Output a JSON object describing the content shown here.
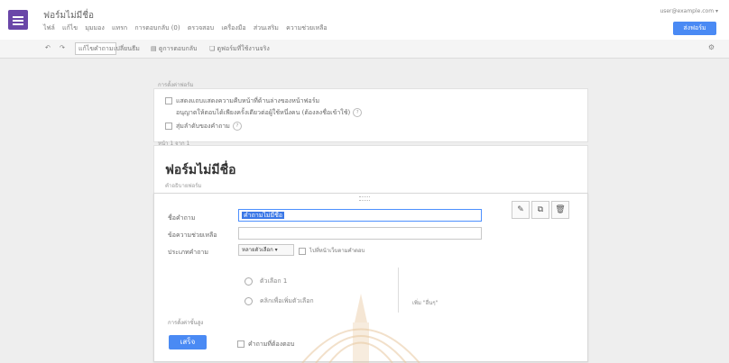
{
  "header": {
    "title": "ฟอร์มไม่มีชื่อ",
    "menu": [
      "ไฟล์",
      "แก้ไข",
      "มุมมอง",
      "แทรก",
      "การตอบกลับ (0)",
      "ตรวจสอบ",
      "เครื่องมือ",
      "ส่วนเสริม",
      "ความช่วยเหลือ"
    ],
    "account": "user@example.com",
    "send_label": "ส่งฟอร์ม"
  },
  "toolbar": {
    "undo": "↶",
    "redo": "↷",
    "edit_questions": "แก้ไขคำถาม",
    "change_theme": "เปลี่ยนธีม",
    "view_responses": "ดูการตอบกลับ",
    "view_live_form": "ดูฟอร์มที่ใช้งานจริง",
    "settings_icon": "gear"
  },
  "settings": {
    "label": "การตั้งค่าฟอร์ม",
    "items": [
      "แสดงแถบแสดงความคืบหน้าที่ด้านล่างของหน้าฟอร์ม",
      "อนุญาตให้ตอบได้เพียงครั้งเดียวต่อผู้ใช้หนึ่งคน (ต้องลงชื่อเข้าใช้)",
      "สุ่มลำดับของคำถาม"
    ]
  },
  "form": {
    "page_label": "หน้า 1 จาก 1",
    "title": "ฟอร์มไม่มีชื่อ",
    "description": "คำอธิบายฟอร์ม"
  },
  "question": {
    "title_label": "ชื่อคำถาม",
    "title_value": "คำถามไม่มีชื่อ",
    "help_label": "ข้อความช่วยเหลือ",
    "help_value": "",
    "type_label": "ประเภทคำถาม",
    "type_value": "หลายตัวเลือก ▾",
    "goto_label": "ไปที่หน้าเว็บตามคำตอบ",
    "option1": "ตัวเลือก 1",
    "option2": "คลิกเพื่อเพิ่มตัวเลือก",
    "add_other": "เพิ่ม \"อื่นๆ\"",
    "advanced": "การตั้งค่าขั้นสูง",
    "done_label": "เสร็จ",
    "required_label": "คำถามที่ต้องตอบ"
  },
  "colors": {
    "brand": "#6a46a8",
    "accent": "#4a8af4"
  }
}
